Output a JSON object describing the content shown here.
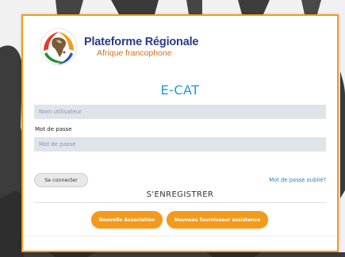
{
  "logo": {
    "title": "Plateforme Régionale",
    "subtitle": "Afrique francophone",
    "icon": "africa-map-logo-icon"
  },
  "app_title": "E-CAT",
  "form": {
    "username_placeholder": "Nom utilisateur",
    "username_value": "",
    "password_label": "Mot de passe",
    "password_placeholder": "Mot de passe",
    "password_value": "",
    "login_button": "Se connecter",
    "forgot_password_link": "Mot de passe oublié?"
  },
  "register": {
    "title": "S'ENREGISTRER",
    "new_association_button": "Nouvelle Association",
    "new_provider_button": "Nouveau fournisseur assistance"
  },
  "colors": {
    "accent_orange": "#f39a1a",
    "brand_blue": "#2a3a86",
    "title_blue": "#1f9ad6",
    "link_blue": "#1f7fc4"
  }
}
